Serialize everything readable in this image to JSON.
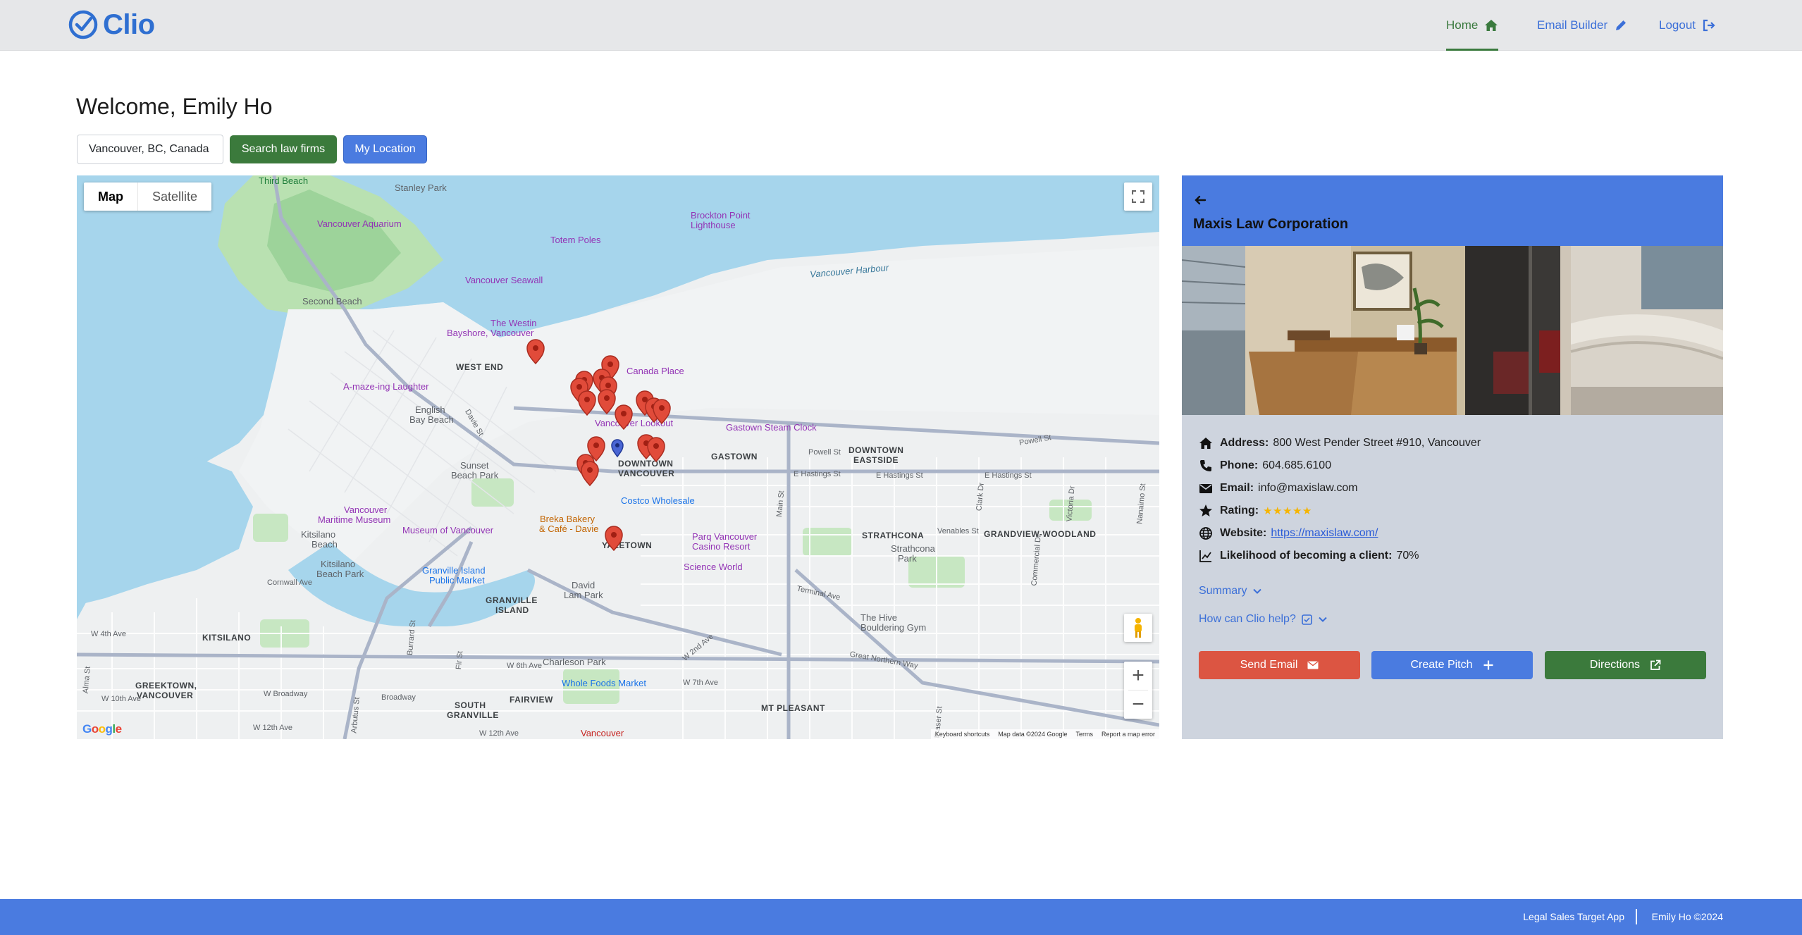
{
  "nav": {
    "brand": "Clio",
    "home": "Home",
    "email_builder": "Email Builder",
    "logout": "Logout",
    "colors": {
      "brand": "#2f6fd1",
      "active": "#3a7a3e",
      "link": "#3b6fd8"
    }
  },
  "welcome": "Welcome, Emily Ho",
  "search": {
    "value": "Vancouver, BC, Canada",
    "search_button": "Search law firms",
    "location_button": "My Location"
  },
  "map": {
    "type_map": "Map",
    "type_satellite": "Satellite",
    "footer": {
      "shortcuts": "Keyboard shortcuts",
      "data": "Map data ©2024 Google",
      "terms": "Terms",
      "report": "Report a map error"
    },
    "google_logo": [
      "G",
      "o",
      "o",
      "g",
      "l",
      "e"
    ],
    "labels": {
      "third_beach": "Third Beach",
      "stanley_park": "Stanley Park",
      "vancouver_aquarium": "Vancouver Aquarium",
      "brockton_point": "Brockton Point",
      "lighthouse": "Lighthouse",
      "totem_poles": "Totem Poles",
      "vancouver_seawall": "Vancouver Seawall",
      "vancouver_harbour": "Vancouver Harbour",
      "second_beach": "Second Beach",
      "westin_1": "The Westin",
      "westin_2": "Bayshore, Vancouver",
      "west_end": "WEST END",
      "canada_place": "Canada Place",
      "amazeing_laughter": "A-maze-ing Laughter",
      "english_bay_1": "English",
      "english_bay_2": "Bay Beach",
      "vancouver_lookout": "Vancouver Lookout",
      "gastown_clock": "Gastown Steam Clock",
      "downtown_eastside_1": "DOWNTOWN",
      "downtown_eastside_2": "EASTSIDE",
      "gastown": "GASTOWN",
      "downtown_1": "DOWNTOWN",
      "downtown_2": "VANCOUVER",
      "sunset_beach_1": "Sunset",
      "sunset_beach_2": "Beach Park",
      "costco": "Costco Wholesale",
      "maritime_1": "Vancouver",
      "maritime_2": "Maritime Museum",
      "museum_vancouver": "Museum of Vancouver",
      "kitsilano_beach_1": "Kitsilano",
      "kitsilano_beach_2": "Beach",
      "kits_beach_park_1": "Kitsilano",
      "kits_beach_park_2": "Beach Park",
      "breka_1": "Breka Bakery",
      "breka_2": "& Café - Davie",
      "yaletown": "YALETOWN",
      "parq_1": "Parq Vancouver",
      "parq_2": "Casino Resort",
      "science_world": "Science World",
      "strathcona": "STRATHCONA",
      "grandview": "GRANDVIEW-WOODLAND",
      "strathcona_park_1": "Strathcona",
      "strathcona_park_2": "Park",
      "granville_market_1": "Granville Island",
      "granville_market_2": "Public Market",
      "granville_island_1": "GRANVILLE",
      "granville_island_2": "ISLAND",
      "david_lam_1": "David",
      "david_lam_2": "Lam Park",
      "hive_1": "The Hive",
      "hive_2": "Bouldering Gym",
      "kitsilano": "KITSILANO",
      "charleson": "Charleson Park",
      "whole_foods": "Whole Foods Market",
      "greektown_1": "GREEKTOWN,",
      "greektown_2": "VANCOUVER",
      "fairview": "FAIRVIEW",
      "south_granville_1": "SOUTH",
      "south_granville_2": "GRANVILLE",
      "mt_pleasant": "MT PLEASANT",
      "vancouver_hospital": "Vancouver",
      "cornwall_ave": "Cornwall Ave",
      "w_4th_ave": "W 4th Ave",
      "w_10th_ave": "W 10th Ave",
      "w_broadway": "W Broadway",
      "w_12th_ave_1": "W 12th Ave",
      "w_12th_ave_2": "W 12th Ave",
      "w_7th_ave": "W 7th Ave",
      "w_6th_ave": "W 6th Ave",
      "broadway": "Broadway",
      "e_hastings_1": "E Hastings St",
      "e_hastings_2": "E Hastings St",
      "e_hastings_3": "E Hastings St",
      "powell_st_1": "Powell St",
      "powell_st_2": "Powell St",
      "venables": "Venables St",
      "terminal_ave": "Terminal Ave",
      "great_northern": "Great Northern Way",
      "w_2nd_ave": "W 2nd Ave",
      "davie_st": "Davie St",
      "burrard_st": "Burrard St",
      "fir_st": "Fir St",
      "arbutus_st": "Arbutus St",
      "alma_st": "Alma St",
      "main_st": "Main St",
      "clark_dr": "Clark Dr",
      "victoria_dr": "Victoria Dr",
      "commercial_dr": "Commercial Dr",
      "nanaimo_st": "Nanaimo St",
      "fraser_st": "Fraser St"
    }
  },
  "firm": {
    "name": "Maxis Law Corporation",
    "address_label": "Address:",
    "address": "800 West Pender Street #910, Vancouver",
    "phone_label": "Phone:",
    "phone": "604.685.6100",
    "email_label": "Email:",
    "email": "info@maxislaw.com",
    "rating_label": "Rating:",
    "rating": 5,
    "rating_stars": "★★★★★",
    "website_label": "Website:",
    "website": "https://maxislaw.com/",
    "likelihood_label": "Likelihood of becoming a client:",
    "likelihood": "70%",
    "summary_label": "Summary",
    "help_label": "How can Clio help?",
    "buttons": {
      "send_email": "Send Email",
      "create_pitch": "Create Pitch",
      "directions": "Directions"
    },
    "colors": {
      "header": "#4a7be0",
      "panel": "#ced4de",
      "email": "#dc5542",
      "pitch": "#4a7be0",
      "directions": "#3b7a3c",
      "star": "#f5b400"
    }
  },
  "footer": {
    "app": "Legal Sales Target App",
    "copyright": "Emily Ho ©2024"
  }
}
